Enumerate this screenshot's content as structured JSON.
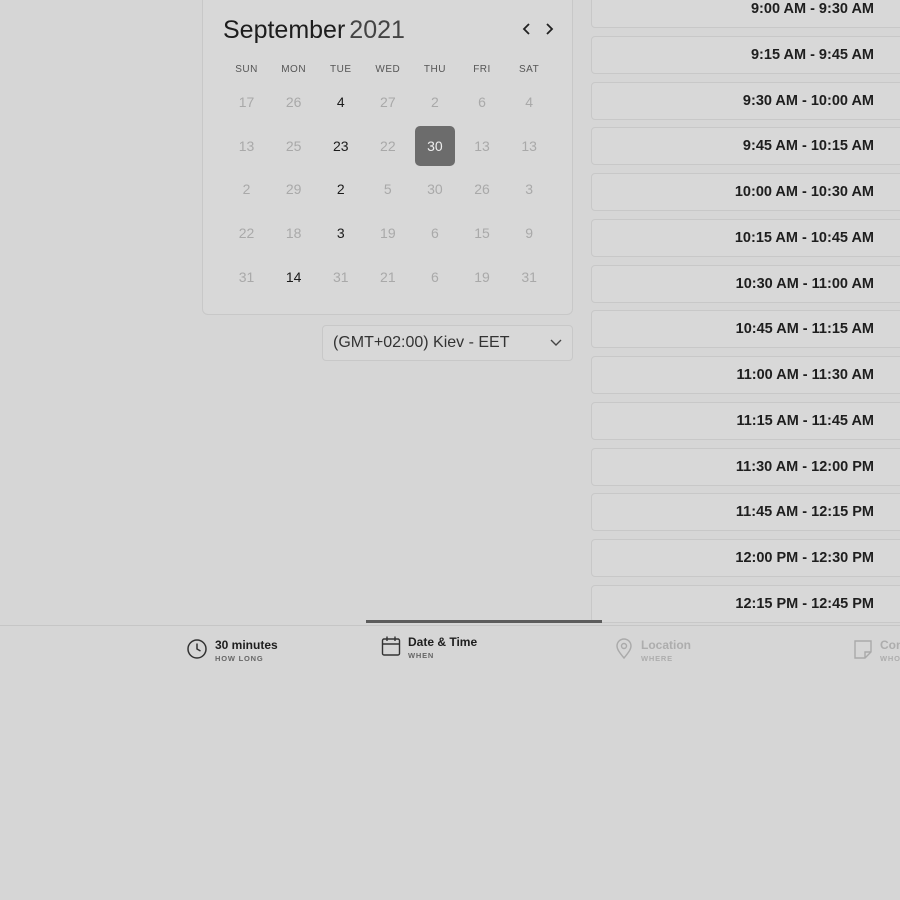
{
  "calendar": {
    "month": "September",
    "year": "2021",
    "prev_icon": "chevron-left-icon",
    "next_icon": "chevron-right-icon",
    "weekdays": [
      "SUN",
      "MON",
      "TUE",
      "WED",
      "THU",
      "FRI",
      "SAT"
    ],
    "days": [
      {
        "label": "17",
        "state": "disabled"
      },
      {
        "label": "26",
        "state": "disabled"
      },
      {
        "label": "4",
        "state": "available"
      },
      {
        "label": "27",
        "state": "disabled"
      },
      {
        "label": "2",
        "state": "disabled"
      },
      {
        "label": "6",
        "state": "disabled"
      },
      {
        "label": "4",
        "state": "disabled"
      },
      {
        "label": "13",
        "state": "disabled"
      },
      {
        "label": "25",
        "state": "disabled"
      },
      {
        "label": "23",
        "state": "available"
      },
      {
        "label": "22",
        "state": "disabled"
      },
      {
        "label": "30",
        "state": "selected"
      },
      {
        "label": "13",
        "state": "disabled"
      },
      {
        "label": "13",
        "state": "disabled"
      },
      {
        "label": "2",
        "state": "disabled"
      },
      {
        "label": "29",
        "state": "disabled"
      },
      {
        "label": "2",
        "state": "available"
      },
      {
        "label": "5",
        "state": "disabled"
      },
      {
        "label": "30",
        "state": "disabled"
      },
      {
        "label": "26",
        "state": "disabled"
      },
      {
        "label": "3",
        "state": "disabled"
      },
      {
        "label": "22",
        "state": "disabled"
      },
      {
        "label": "18",
        "state": "disabled"
      },
      {
        "label": "3",
        "state": "available"
      },
      {
        "label": "19",
        "state": "disabled"
      },
      {
        "label": "6",
        "state": "disabled"
      },
      {
        "label": "15",
        "state": "disabled"
      },
      {
        "label": "9",
        "state": "disabled"
      },
      {
        "label": "31",
        "state": "disabled"
      },
      {
        "label": "14",
        "state": "available"
      },
      {
        "label": "31",
        "state": "disabled"
      },
      {
        "label": "21",
        "state": "disabled"
      },
      {
        "label": "6",
        "state": "disabled"
      },
      {
        "label": "19",
        "state": "disabled"
      },
      {
        "label": "31",
        "state": "disabled"
      }
    ]
  },
  "timezone": {
    "value": "(GMT+02:00) Kiev - EET",
    "icon": "chevron-down-icon"
  },
  "time_slots": [
    "9:00 AM - 9:30 AM",
    "9:15 AM - 9:45 AM",
    "9:30 AM - 10:00 AM",
    "9:45 AM - 10:15 AM",
    "10:00 AM - 10:30 AM",
    "10:15 AM - 10:45 AM",
    "10:30 AM - 11:00 AM",
    "10:45 AM - 11:15 AM",
    "11:00 AM - 11:30 AM",
    "11:15 AM - 11:45 AM",
    "11:30 AM - 12:00 PM",
    "11:45 AM - 12:15 PM",
    "12:00 PM - 12:30 PM",
    "12:15 PM - 12:45 PM"
  ],
  "steps": [
    {
      "title": "30 minutes",
      "subtitle": "HOW LONG",
      "icon": "clock-icon",
      "state": "done"
    },
    {
      "title": "Date & Time",
      "subtitle": "WHEN",
      "icon": "calendar-icon",
      "state": "active"
    },
    {
      "title": "Location",
      "subtitle": "WHERE",
      "icon": "map-pin-icon",
      "state": "upcoming"
    },
    {
      "title": "Con",
      "subtitle": "WHO",
      "icon": "note-icon",
      "state": "upcoming"
    }
  ],
  "colors": {
    "background": "#d6d6d6",
    "selected_day": "#6c6c6c",
    "active_step_indicator": "#5c5c5c"
  }
}
